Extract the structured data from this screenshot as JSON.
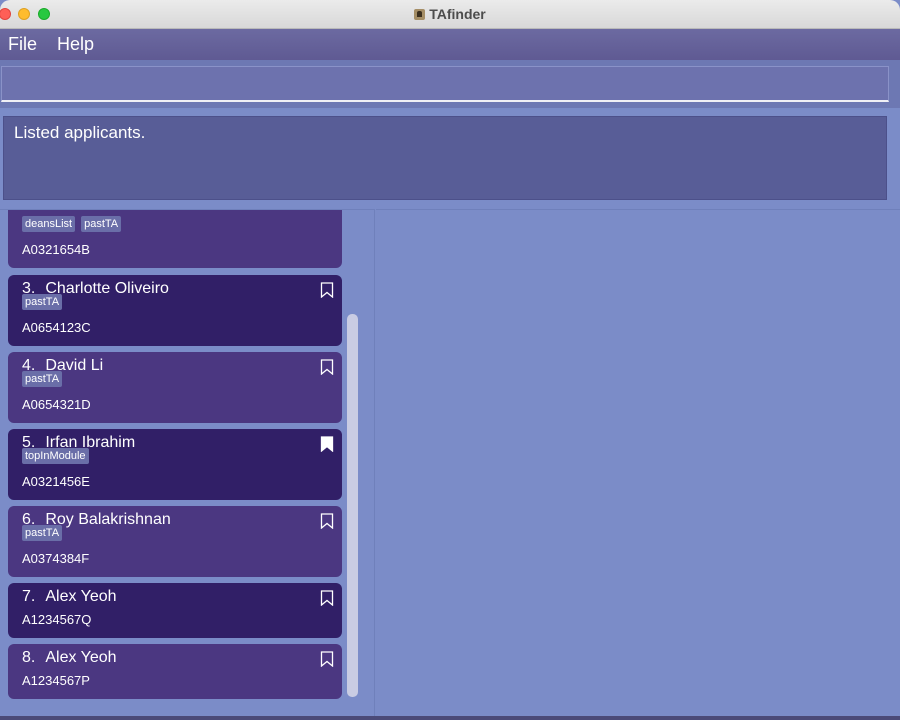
{
  "window": {
    "title": "TAfinder"
  },
  "menu": {
    "file": "File",
    "help": "Help"
  },
  "command": {
    "value": "",
    "placeholder": ""
  },
  "result": {
    "message": "Listed applicants."
  },
  "applicants": [
    {
      "index": "",
      "name": "",
      "tags": [
        "deansList",
        "pastTA"
      ],
      "id": "A0321654B",
      "bookmarked": false,
      "partial": true
    },
    {
      "index": "3.",
      "name": "Charlotte Oliveiro",
      "tags": [
        "pastTA"
      ],
      "id": "A0654123C",
      "bookmarked": false
    },
    {
      "index": "4.",
      "name": "David Li",
      "tags": [
        "pastTA"
      ],
      "id": "A0654321D",
      "bookmarked": false
    },
    {
      "index": "5.",
      "name": "Irfan Ibrahim",
      "tags": [
        "topInModule"
      ],
      "id": "A0321456E",
      "bookmarked": true
    },
    {
      "index": "6.",
      "name": "Roy Balakrishnan",
      "tags": [
        "pastTA"
      ],
      "id": "A0374384F",
      "bookmarked": false
    },
    {
      "index": "7.",
      "name": "Alex Yeoh",
      "tags": [],
      "id": "A1234567Q",
      "bookmarked": false
    },
    {
      "index": "8.",
      "name": "Alex Yeoh",
      "tags": [],
      "id": "A1234567P",
      "bookmarked": false
    }
  ]
}
